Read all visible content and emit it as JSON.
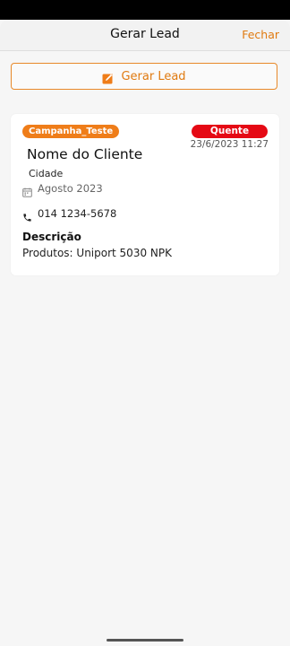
{
  "header": {
    "title": "Gerar Lead",
    "close_label": "Fechar"
  },
  "action_button": {
    "label": "Gerar Lead",
    "icon": "edit-icon"
  },
  "lead_card": {
    "campaign": "Campanha_Teste",
    "temperature": "Quente",
    "datetime": "23/6/2023 11:27",
    "client_name": "Nome do Cliente",
    "city": "Cidade",
    "month": "Agosto 2023",
    "phone": "014 1234-5678",
    "description_label": "Descrição",
    "description": "Produtos: Uniport 5030 NPK"
  },
  "colors": {
    "accent": "#e07a10",
    "badge_campaign": "#ef7d19",
    "badge_temperature": "#e50914",
    "background": "#f6f6f6"
  }
}
